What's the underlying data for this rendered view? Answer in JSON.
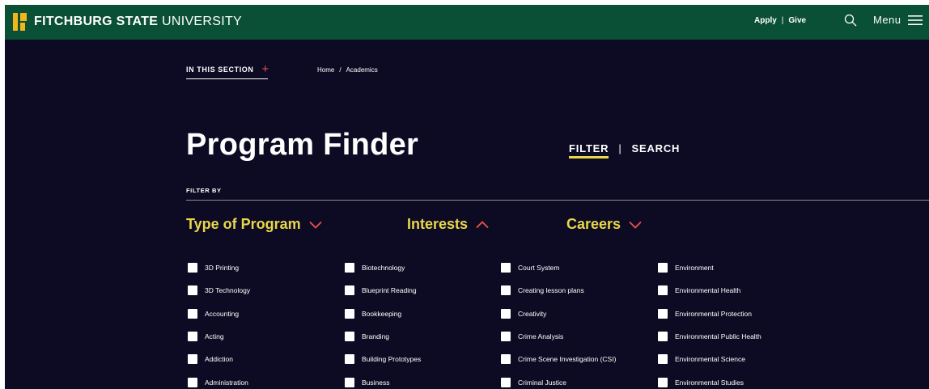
{
  "header": {
    "logo": {
      "strong": "FITCHBURG STATE",
      "light": "UNIVERSITY"
    },
    "apply_label": "Apply",
    "separator": "|",
    "give_label": "Give",
    "search_icon": "search-icon",
    "menu_label": "Menu",
    "menu_icon": "hamburger-icon",
    "colors": {
      "bar": "#0a5036",
      "logo_accent": "#f3b51a"
    }
  },
  "section_nav": {
    "in_this_section": "IN THIS SECTION",
    "plus": "+"
  },
  "breadcrumb": {
    "items": [
      "Home",
      "Academics"
    ],
    "separator": "/"
  },
  "page": {
    "title": "Program Finder",
    "tabs": {
      "filter": "FILTER",
      "divider": "|",
      "search": "SEARCH",
      "active": "filter"
    },
    "filter_by": "FILTER BY",
    "colors": {
      "background": "#0c0b23",
      "accent": "#e9d74a",
      "chevron": "#f0534b"
    }
  },
  "filters": {
    "categories": [
      {
        "label": "Type of Program",
        "state": "collapsed",
        "icon": "chevron-down-icon"
      },
      {
        "label": "Interests",
        "state": "expanded",
        "icon": "chevron-up-icon"
      },
      {
        "label": "Careers",
        "state": "collapsed",
        "icon": "chevron-down-icon"
      }
    ],
    "columns": [
      [
        "3D Printing",
        "3D Technology",
        "Accounting",
        "Acting",
        "Addiction",
        "Administration"
      ],
      [
        "Biotechnology",
        "Blueprint Reading",
        "Bookkeeping",
        "Branding",
        "Building Prototypes",
        "Business"
      ],
      [
        "Court System",
        "Creating lesson plans",
        "Creativity",
        "Crime Analysis",
        "Crime Scene Investigation (CSI)",
        "Criminal Justice"
      ],
      [
        "Environment",
        "Environmental Health",
        "Environmental Protection",
        "Environmental Public Health",
        "Environmental Science",
        "Environmental Studies"
      ]
    ]
  }
}
